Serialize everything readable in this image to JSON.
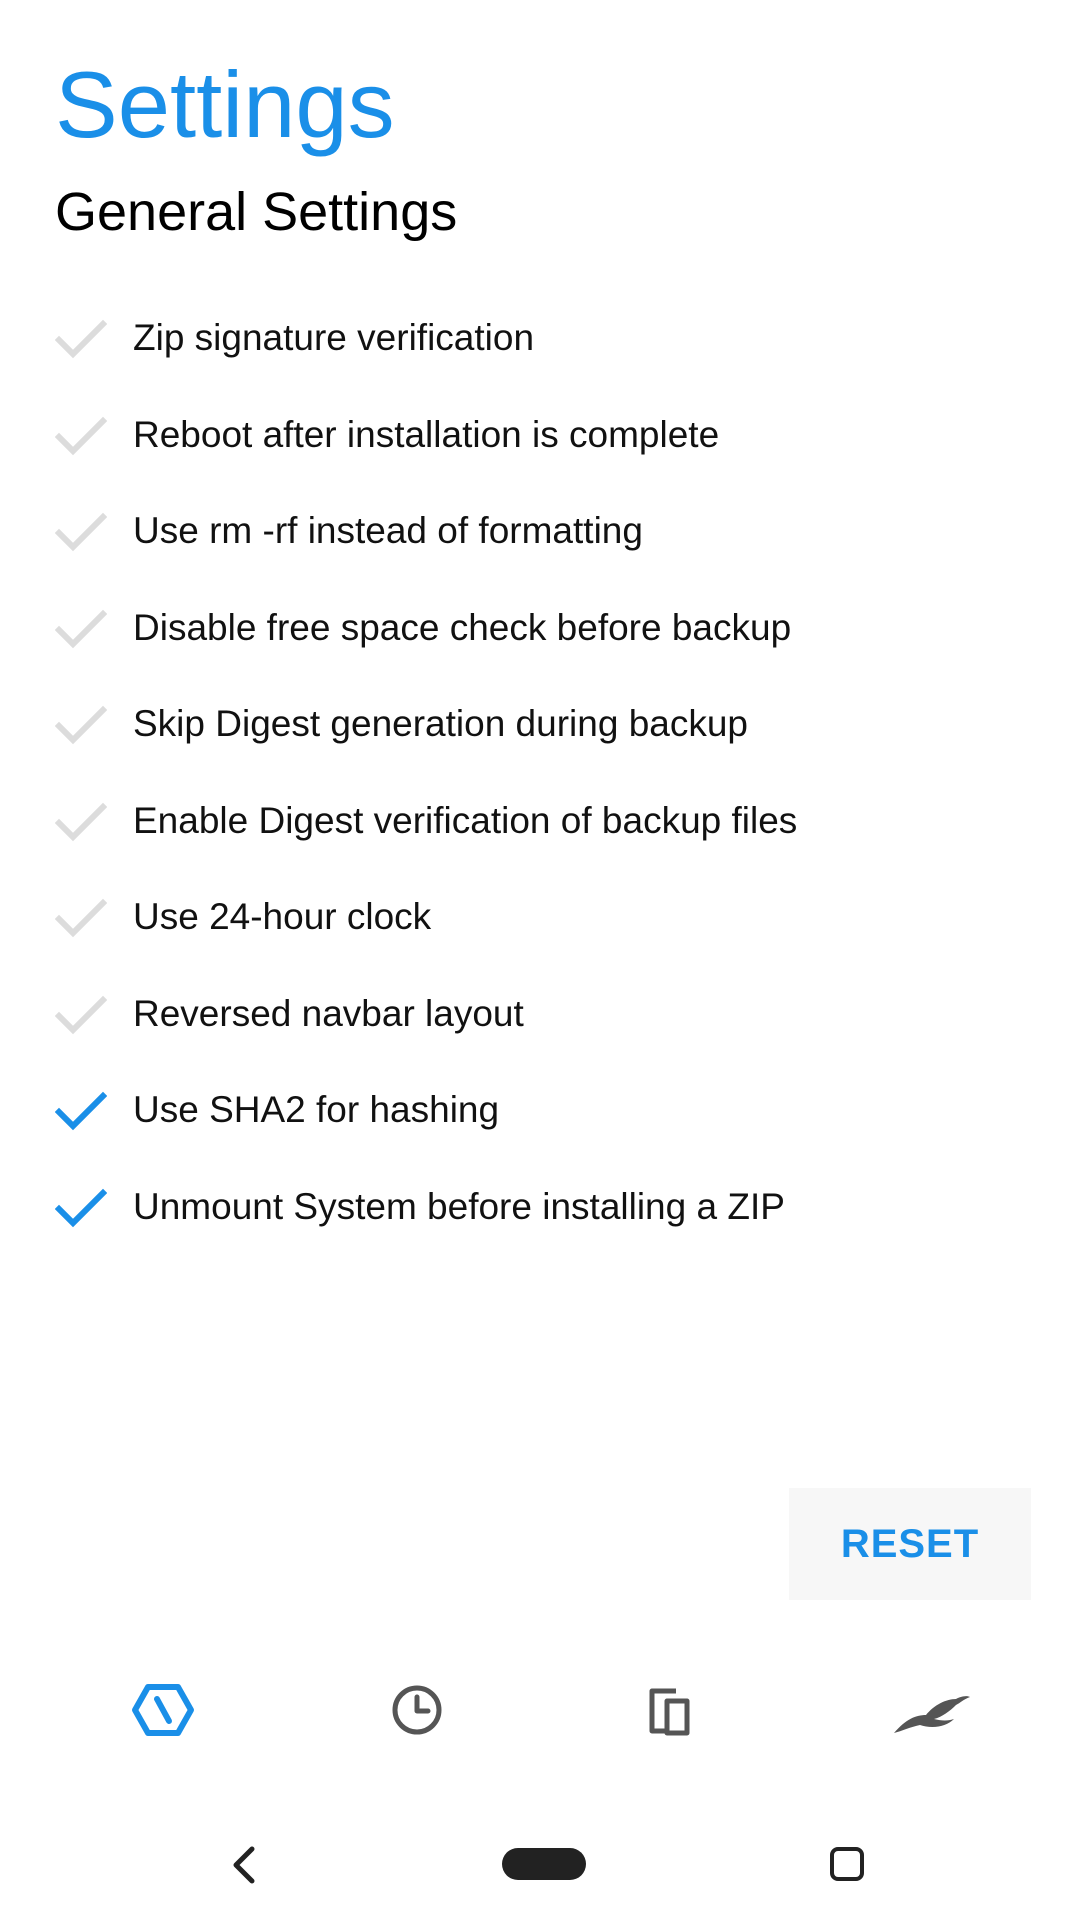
{
  "header": {
    "title": "Settings",
    "section_title": "General Settings"
  },
  "settings": [
    {
      "label": "Zip signature verification",
      "checked": false
    },
    {
      "label": "Reboot after installation is complete",
      "checked": false
    },
    {
      "label": "Use rm -rf instead of formatting",
      "checked": false
    },
    {
      "label": "Disable free space check before backup",
      "checked": false
    },
    {
      "label": "Skip Digest generation during backup",
      "checked": false
    },
    {
      "label": "Enable Digest verification of backup files",
      "checked": false
    },
    {
      "label": "Use 24-hour clock",
      "checked": false
    },
    {
      "label": "Reversed navbar layout",
      "checked": false
    },
    {
      "label": "Use SHA2 for hashing",
      "checked": true
    },
    {
      "label": "Unmount System before installing a ZIP",
      "checked": true
    }
  ],
  "actions": {
    "reset_label": "RESET"
  },
  "bottom_nav": [
    {
      "icon": "settings-hexagon-icon",
      "active": true
    },
    {
      "icon": "clock-icon",
      "active": false
    },
    {
      "icon": "devices-icon",
      "active": false
    },
    {
      "icon": "bird-logo-icon",
      "active": false
    }
  ],
  "colors": {
    "accent": "#1a8fe8",
    "checked_mark": "#1a8fe8",
    "unchecked_mark": "#dcdcdc",
    "inactive_icon": "#555555"
  }
}
